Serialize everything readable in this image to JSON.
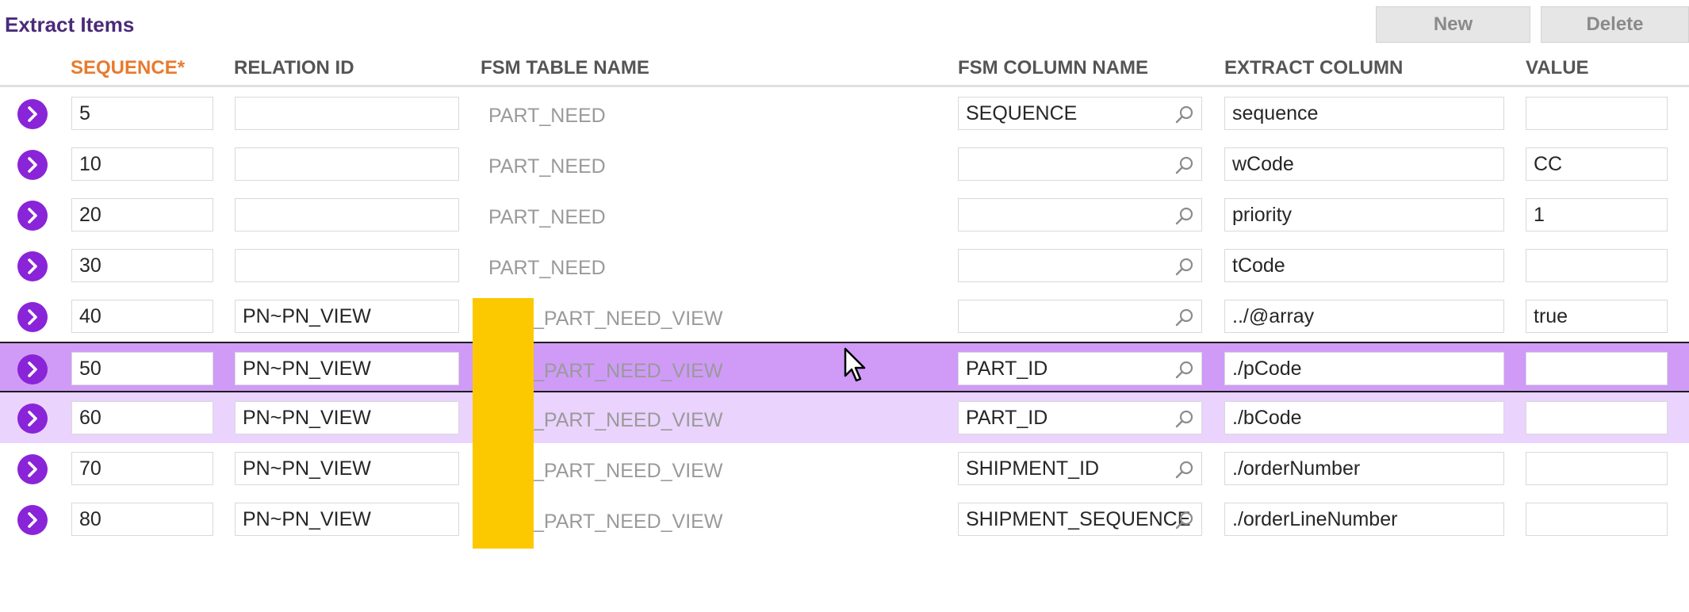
{
  "page": {
    "title": "Extract Items"
  },
  "toolbar": {
    "new_label": "New",
    "delete_label": "Delete"
  },
  "columns": {
    "sequence": "SEQUENCE*",
    "relation_id": "RELATION ID",
    "fsm_table_name": "FSM TABLE NAME",
    "fsm_column_name": "FSM COLUMN NAME",
    "extract_column": "EXTRACT COLUMN",
    "value": "VALUE"
  },
  "rows": [
    {
      "sequence": "5",
      "relation_id": "",
      "fsm_table_name": "PART_NEED",
      "fsm_column_name": "SEQUENCE",
      "extract_column": "sequence",
      "value": ""
    },
    {
      "sequence": "10",
      "relation_id": "",
      "fsm_table_name": "PART_NEED",
      "fsm_column_name": "",
      "extract_column": "wCode",
      "value": "CC"
    },
    {
      "sequence": "20",
      "relation_id": "",
      "fsm_table_name": "PART_NEED",
      "fsm_column_name": "",
      "extract_column": "priority",
      "value": "1"
    },
    {
      "sequence": "30",
      "relation_id": "",
      "fsm_table_name": "PART_NEED",
      "fsm_column_name": "",
      "extract_column": "tCode",
      "value": ""
    },
    {
      "sequence": "40",
      "relation_id": "PN~PN_VIEW",
      "fsm_table_name": "_PART_NEED_VIEW",
      "fsm_column_name": "",
      "extract_column": "../@array",
      "value": "true"
    },
    {
      "sequence": "50",
      "relation_id": "PN~PN_VIEW",
      "fsm_table_name": "_PART_NEED_VIEW",
      "fsm_column_name": "PART_ID",
      "extract_column": "./pCode",
      "value": ""
    },
    {
      "sequence": "60",
      "relation_id": "PN~PN_VIEW",
      "fsm_table_name": "_PART_NEED_VIEW",
      "fsm_column_name": "PART_ID",
      "extract_column": "./bCode",
      "value": ""
    },
    {
      "sequence": "70",
      "relation_id": "PN~PN_VIEW",
      "fsm_table_name": "_PART_NEED_VIEW",
      "fsm_column_name": "SHIPMENT_ID",
      "extract_column": "./orderNumber",
      "value": ""
    },
    {
      "sequence": "80",
      "relation_id": "PN~PN_VIEW",
      "fsm_table_name": "_PART_NEED_VIEW",
      "fsm_column_name": "SHIPMENT_SEQUENCE",
      "extract_column": "./orderLineNumber",
      "value": ""
    }
  ],
  "state": {
    "selected_row_sequence": "50",
    "hovered_row_sequence": "60"
  },
  "colors": {
    "accent": "#8a24d8",
    "selected_row": "#cf9bf7",
    "hover_row": "#ead3fd",
    "required_header": "#e87a2d",
    "redaction": "#fcc800"
  },
  "icons": {
    "row_open": "chevron-right-circle-icon",
    "lookup": "search-icon",
    "pointer": "mouse-cursor-icon"
  }
}
